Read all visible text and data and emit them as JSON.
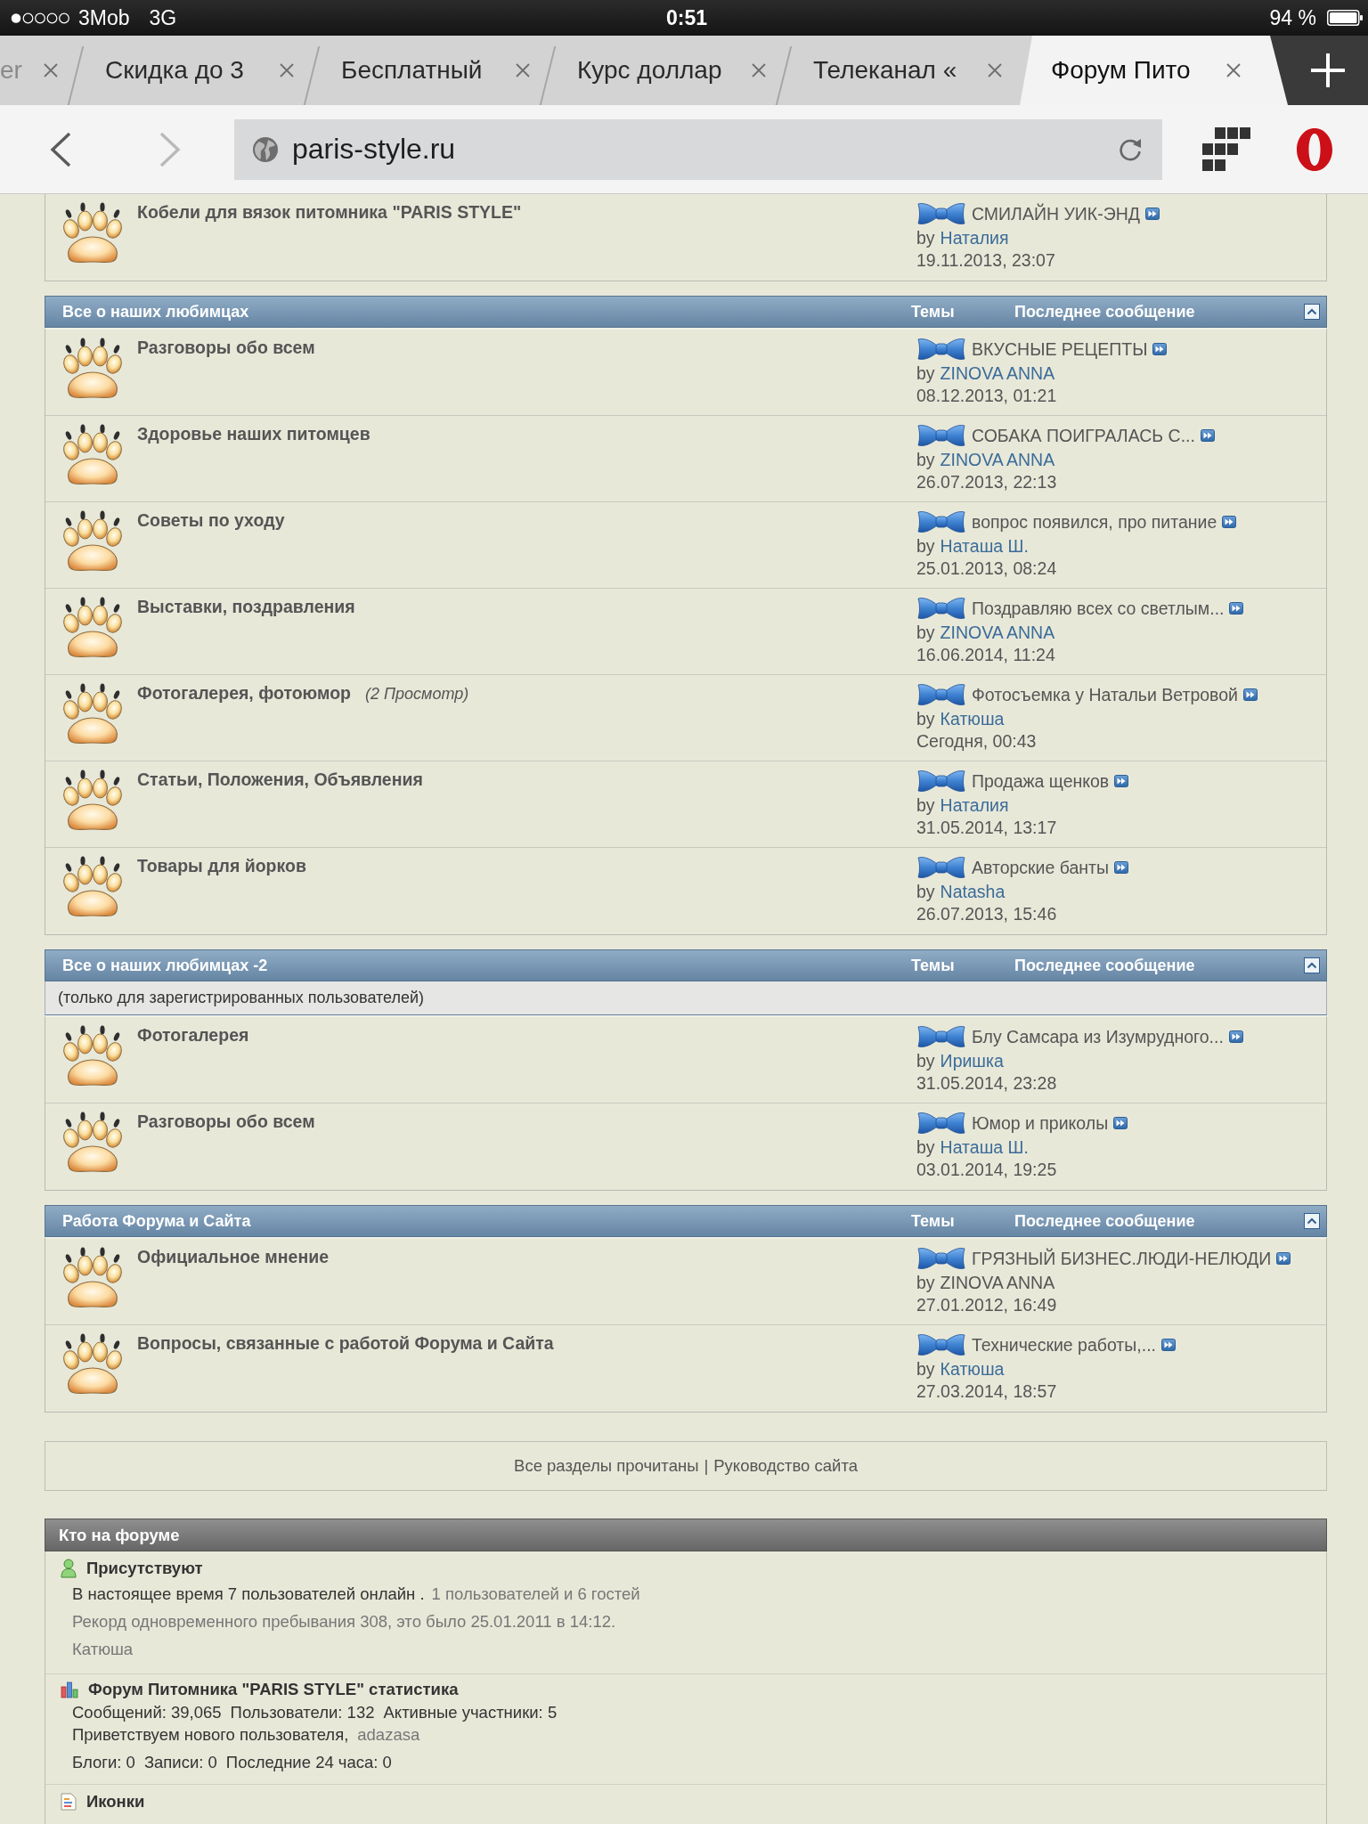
{
  "status_bar": {
    "carrier": "3Mob",
    "network": "3G",
    "time": "0:51",
    "battery": "94 %"
  },
  "tabs": [
    {
      "label": "er",
      "selected": false
    },
    {
      "label": "Скидка до 3",
      "selected": false
    },
    {
      "label": "Бесплатный",
      "selected": false
    },
    {
      "label": "Курс доллар",
      "selected": false
    },
    {
      "label": "Телеканал «",
      "selected": false
    },
    {
      "label": "Форум Пито",
      "selected": true
    }
  ],
  "toolbar": {
    "back_button": {
      "disabled": false
    },
    "forward_button": {
      "disabled": true
    },
    "url": "paris-style.ru"
  },
  "categories": [
    {
      "rows": [
        {
          "title": "Кобели для вязок питомника \"PARIS STYLE\"",
          "last_post": {
            "title": "СМИЛАЙН УИК-ЭНД",
            "by": "by",
            "author": "Наталия",
            "author_linked": true,
            "date": "19.11.2013, 23:07"
          }
        }
      ]
    },
    {
      "title": "Все о наших любимцах",
      "columns": [
        "Темы",
        "Последнее сообщение"
      ],
      "rows": [
        {
          "title": "Разговоры обо всем",
          "last_post": {
            "title": "ВКУСНЫЕ РЕЦЕПТЫ",
            "by": "by",
            "author": "ZINOVA ANNA",
            "author_linked": true,
            "date": "08.12.2013, 01:21"
          }
        },
        {
          "title": "Здоровье наших питомцев",
          "last_post": {
            "title": "СОБАКА ПОИГРАЛАСЬ С...",
            "by": "by",
            "author": "ZINOVA ANNA",
            "author_linked": true,
            "date": "26.07.2013, 22:13"
          }
        },
        {
          "title": "Советы по уходу",
          "last_post": {
            "title": "вопрос появился, про питание",
            "by": "by",
            "author": "Наташа Ш.",
            "author_linked": true,
            "date": "25.01.2013, 08:24"
          }
        },
        {
          "title": "Выставки, поздравления",
          "last_post": {
            "title": "Поздравляю всех со светлым...",
            "by": "by",
            "author": "ZINOVA ANNA",
            "author_linked": true,
            "date": "16.06.2014, 11:24"
          }
        },
        {
          "title": "Фотогалерея, фотоюмор",
          "viewers": "(2 Просмотр)",
          "last_post": {
            "title": "Фотосъемка у Натальи Ветровой",
            "by": "by",
            "author": "Катюша",
            "author_linked": true,
            "date": "Сегодня, 00:43"
          }
        },
        {
          "title": "Статьи, Положения, Объявления",
          "last_post": {
            "title": "Продажа щенков",
            "by": "by",
            "author": "Наталия",
            "author_linked": true,
            "date": "31.05.2014, 13:17"
          }
        },
        {
          "title": "Товары для йорков",
          "last_post": {
            "title": "Авторские банты",
            "by": "by",
            "author": "Natasha",
            "author_linked": true,
            "date": "26.07.2013, 15:46"
          }
        }
      ]
    },
    {
      "title": "Все о наших любимцах -2",
      "columns": [
        "Темы",
        "Последнее сообщение"
      ],
      "note": "(только для зарегистрированных пользователей)",
      "rows": [
        {
          "title": "Фотогалерея",
          "last_post": {
            "title": "Блу Самсара из Изумрудного...",
            "by": "by",
            "author": "Иришка",
            "author_linked": true,
            "date": "31.05.2014, 23:28"
          }
        },
        {
          "title": "Разговоры обо всем",
          "last_post": {
            "title": "Юмор и приколы",
            "by": "by",
            "author": "Наташа Ш.",
            "author_linked": true,
            "date": "03.01.2014, 19:25"
          }
        }
      ]
    },
    {
      "title": "Работа Форума и Сайта",
      "columns": [
        "Темы",
        "Последнее сообщение"
      ],
      "rows": [
        {
          "title": "Официальное мнение",
          "last_post": {
            "title": "ГРЯЗНЫЙ БИЗНЕС.ЛЮДИ-НЕЛЮДИ",
            "by": "by",
            "author": "ZINOVA ANNA",
            "author_linked": false,
            "date": "27.01.2012, 16:49"
          }
        },
        {
          "title": "Вопросы, связанные с работой Форума и Сайта",
          "last_post": {
            "title": "Технические работы,...",
            "by": "by",
            "author": "Катюша",
            "author_linked": true,
            "date": "27.03.2014, 18:57"
          }
        }
      ]
    }
  ],
  "footer": {
    "links": [
      "Все разделы прочитаны",
      "Руководство сайта"
    ],
    "separator": "|"
  },
  "who_online": {
    "title": "Кто на форуме",
    "sections": [
      {
        "kind": "online",
        "heading": "Присутствуют",
        "lines": [
          [
            {
              "kind": "text",
              "text": "В настоящее время 7 пользователей онлайн ."
            },
            {
              "kind": "muted",
              "text": "1 пользователей и 6 гостей"
            }
          ],
          [
            {
              "kind": "muted",
              "text": "Рекорд одновременного пребывания 308, это было 25.01.2011 в 14:12."
            }
          ],
          [
            {
              "kind": "link",
              "text": "Катюша"
            }
          ]
        ]
      },
      {
        "kind": "stats",
        "heading": "Форум Питомника \"PARIS STYLE\" статистика",
        "lines": [
          [
            {
              "kind": "text",
              "text": "Сообщений: 39,065"
            },
            {
              "kind": "text",
              "text": "Пользователи: 132"
            },
            {
              "kind": "text",
              "text": "Активные участники: 5"
            }
          ],
          [
            {
              "kind": "text",
              "text": "Приветствуем нового пользователя,"
            },
            {
              "kind": "link",
              "text": "adazasa"
            }
          ],
          [
            {
              "kind": "text",
              "text": "Блоги: 0"
            },
            {
              "kind": "text",
              "text": "Записи: 0"
            },
            {
              "kind": "text",
              "text": "Последние 24 часа: 0"
            }
          ]
        ]
      },
      {
        "kind": "icons",
        "heading": "Иконки"
      }
    ]
  }
}
